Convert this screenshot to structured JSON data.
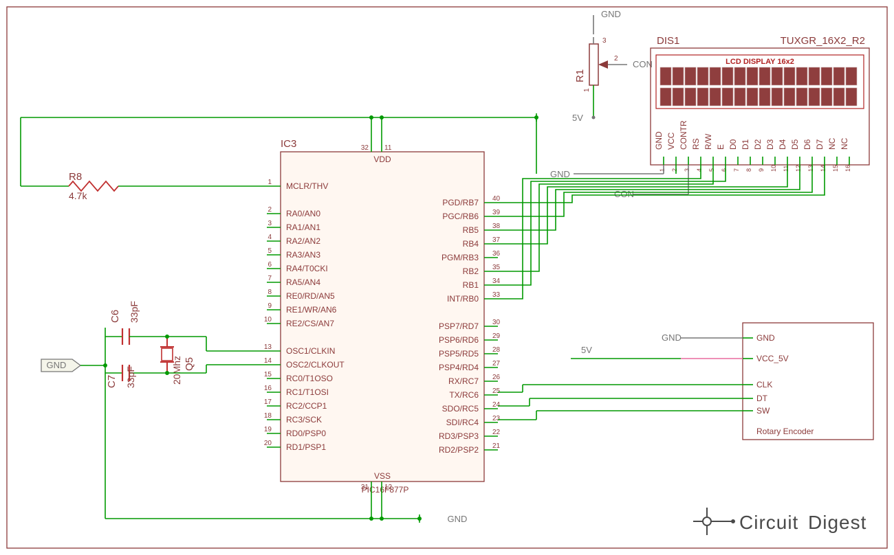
{
  "schematic": {
    "mcu": {
      "ref": "IC3",
      "part": "PIC16F877P",
      "topLabel": "VDD",
      "bottomLabel": "VSS",
      "topPins": [
        "32",
        "11"
      ],
      "bottomPins": [
        "31",
        "12"
      ],
      "leftPins": [
        {
          "n": "1",
          "t": "MCLR/THV",
          "bar": "MCLR"
        },
        {
          "n": "2",
          "t": "RA0/AN0"
        },
        {
          "n": "3",
          "t": "RA1/AN1"
        },
        {
          "n": "4",
          "t": "RA2/AN2"
        },
        {
          "n": "5",
          "t": "RA3/AN3"
        },
        {
          "n": "6",
          "t": "RA4/T0CKI"
        },
        {
          "n": "7",
          "t": "RA5/AN4"
        },
        {
          "n": "8",
          "t": "RE0/RD/AN5",
          "bar": "RD"
        },
        {
          "n": "9",
          "t": "RE1/WR/AN6",
          "bar": "WR"
        },
        {
          "n": "10",
          "t": "RE2/CS/AN7",
          "bar": "CS"
        },
        {
          "n": "13",
          "t": "OSC1/CLKIN"
        },
        {
          "n": "14",
          "t": "OSC2/CLKOUT"
        },
        {
          "n": "15",
          "t": "RC0/T1OSO"
        },
        {
          "n": "16",
          "t": "RC1/T1OSI"
        },
        {
          "n": "17",
          "t": "RC2/CCP1"
        },
        {
          "n": "18",
          "t": "RC3/SCK"
        },
        {
          "n": "19",
          "t": "RD0/PSP0"
        },
        {
          "n": "20",
          "t": "RD1/PSP1"
        }
      ],
      "rightPins": [
        {
          "n": "40",
          "t": "PGD/RB7"
        },
        {
          "n": "39",
          "t": "PGC/RB6"
        },
        {
          "n": "38",
          "t": "RB5"
        },
        {
          "n": "37",
          "t": "RB4"
        },
        {
          "n": "36",
          "t": "PGM/RB3"
        },
        {
          "n": "35",
          "t": "RB2"
        },
        {
          "n": "34",
          "t": "RB1"
        },
        {
          "n": "33",
          "t": "INT/RB0"
        },
        {
          "n": "30",
          "t": "PSP7/RD7"
        },
        {
          "n": "29",
          "t": "PSP6/RD6"
        },
        {
          "n": "28",
          "t": "PSP5/RD5"
        },
        {
          "n": "27",
          "t": "PSP4/RD4"
        },
        {
          "n": "26",
          "t": "RX/RC7"
        },
        {
          "n": "25",
          "t": "TX/RC6"
        },
        {
          "n": "24",
          "t": "SDO/RC5"
        },
        {
          "n": "23",
          "t": "SDI/RC4"
        },
        {
          "n": "22",
          "t": "RD3/PSP3"
        },
        {
          "n": "21",
          "t": "RD2/PSP2"
        }
      ]
    },
    "lcd": {
      "ref": "DIS1",
      "type": "TUXGR_16X2_R2",
      "title": "LCD DISPLAY 16x2",
      "pins": [
        "GND",
        "VCC",
        "CONTR",
        "RS",
        "R/W",
        "E",
        "D0",
        "D1",
        "D2",
        "D3",
        "D4",
        "D5",
        "D6",
        "D7",
        "NC",
        "NC"
      ],
      "pinNums": [
        "1",
        "2",
        "3",
        "4",
        "5",
        "6",
        "7",
        "8",
        "9",
        "10",
        "11",
        "12",
        "13",
        "14",
        "15",
        "16"
      ]
    },
    "encoder": {
      "title": "Rotary Encoder",
      "pins": [
        "GND",
        "VCC_5V",
        "CLK",
        "DT",
        "SW"
      ]
    },
    "passives": {
      "R1": {
        "ref": "R1",
        "pins": [
          "1",
          "2",
          "3"
        ]
      },
      "R8": {
        "ref": "R8",
        "val": "4.7k"
      },
      "C6": {
        "ref": "C6",
        "val": "33pF"
      },
      "C7": {
        "ref": "C7",
        "val": "33pF"
      },
      "Q5": {
        "ref": "Q5",
        "val": "20Mhz"
      }
    },
    "nets": {
      "gnd": "GND",
      "v5": "5V",
      "con": "CON"
    },
    "brand1": "Circuit",
    "brand2": "Digest"
  }
}
